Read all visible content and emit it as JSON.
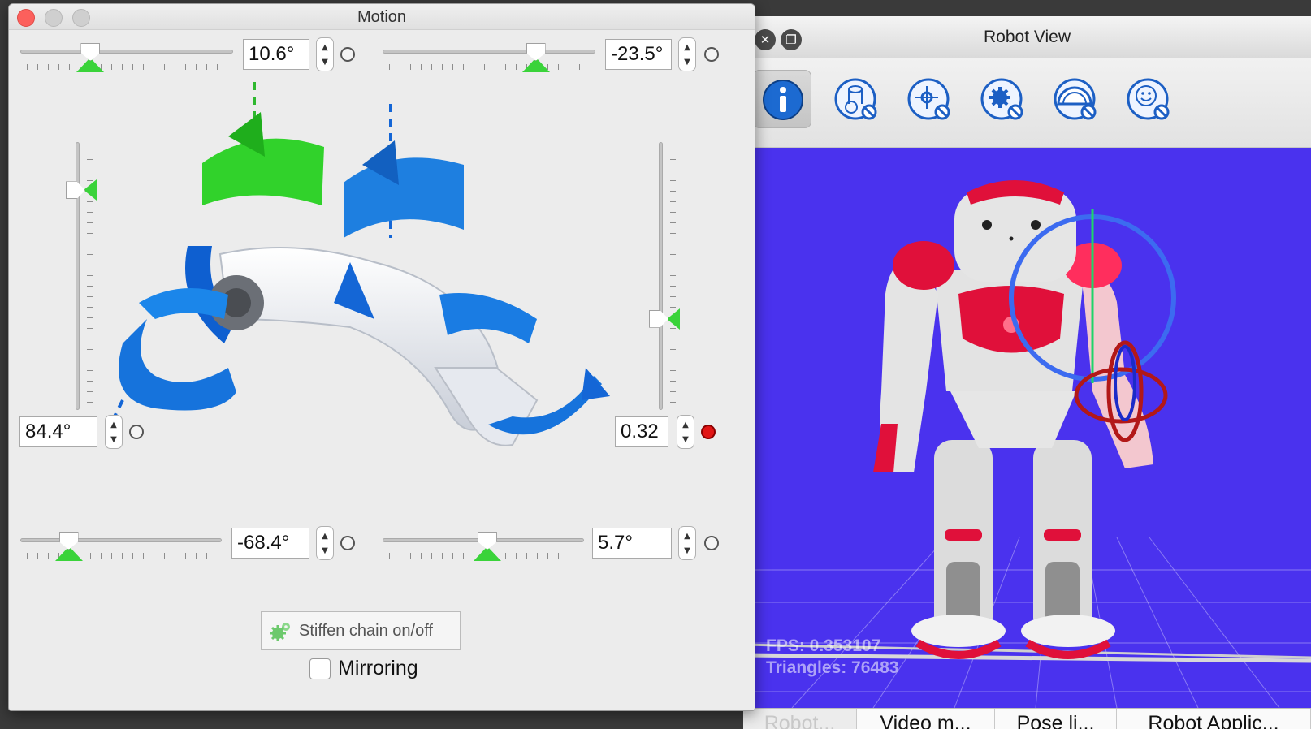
{
  "motion_window": {
    "title": "Motion",
    "joints": {
      "top_left": {
        "value": "10.6°",
        "position": 0.33,
        "marker": 0.33
      },
      "top_right": {
        "value": "-23.5°",
        "position": 0.72,
        "marker": 0.72
      },
      "left_vertical": {
        "value": "84.4°",
        "position": 0.18,
        "marker": 0.18
      },
      "right_vertical": {
        "value": "0.32",
        "position": 0.66,
        "marker": 0.66,
        "status": "red"
      },
      "bottom_left": {
        "value": "-68.4°",
        "position": 0.24,
        "marker": 0.24
      },
      "bottom_right": {
        "value": "5.7°",
        "position": 0.52,
        "marker": 0.52
      }
    },
    "stiffen_button": "Stiffen chain on/off",
    "mirroring_label": "Mirroring",
    "mirroring_checked": false
  },
  "robot_view": {
    "title": "Robot View",
    "toolbar_icons": [
      "info-icon",
      "cylinder-icon",
      "joint-icon",
      "gear-icon",
      "gauge-icon",
      "face-icon"
    ],
    "hud": {
      "fps": "FPS: 0.353107",
      "triangles": "Triangles: 76483"
    },
    "tabs": [
      "Robot...",
      "Video m...",
      "Pose li...",
      "Robot Applic..."
    ],
    "active_tab": 0
  },
  "colors": {
    "viewport_bg": "#4a32ee",
    "marker_green": "#3ad33a",
    "robot_red": "#e0103a",
    "close_red": "#fc605c"
  }
}
